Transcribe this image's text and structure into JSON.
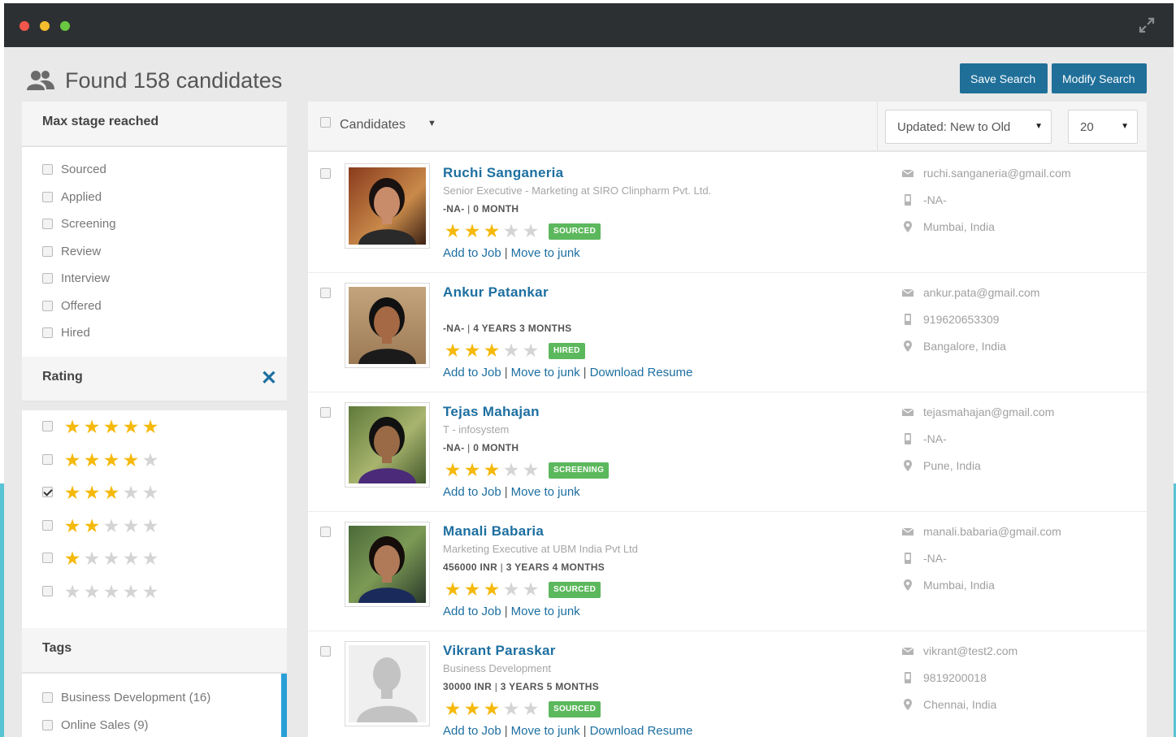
{
  "header": {
    "title": "Found 158 candidates",
    "save_search": "Save Search",
    "modify_search": "Modify Search"
  },
  "sidebar": {
    "stage": {
      "title": "Max stage reached",
      "items": [
        "Sourced",
        "Applied",
        "Screening",
        "Review",
        "Interview",
        "Offered",
        "Hired"
      ]
    },
    "rating": {
      "title": "Rating",
      "clear": "✕",
      "options": [
        {
          "stars": 5,
          "checked": false
        },
        {
          "stars": 4,
          "checked": false
        },
        {
          "stars": 3,
          "checked": true
        },
        {
          "stars": 2,
          "checked": false
        },
        {
          "stars": 1,
          "checked": false
        },
        {
          "stars": 0,
          "checked": false
        }
      ]
    },
    "tags": {
      "title": "Tags",
      "items": [
        "Business Development (16)",
        "Online Sales (9)"
      ]
    }
  },
  "toolbar": {
    "label": "Candidates",
    "sort_value": "Updated: New to Old",
    "count_value": "20"
  },
  "candidates": [
    {
      "name": "Ruchi Sanganeria",
      "title": "Senior Executive - Marketing at SIRO Clinpharm Pvt. Ltd.",
      "salary": "-NA-",
      "experience": "0 MONTH",
      "rating": 3,
      "stage": "SOURCED",
      "actions": [
        "Add to Job",
        "Move to junk"
      ],
      "email": "ruchi.sanganeria@gmail.com",
      "phone": "-NA-",
      "location": "Mumbai, India"
    },
    {
      "name": "Ankur Patankar",
      "title": "",
      "salary": "-NA-",
      "experience": "4 YEARS 3 MONTHS",
      "rating": 3,
      "stage": "HIRED",
      "actions": [
        "Add to Job",
        "Move to junk",
        "Download Resume"
      ],
      "email": "ankur.pata@gmail.com",
      "phone": "919620653309",
      "location": "Bangalore, India"
    },
    {
      "name": "Tejas Mahajan",
      "title": "T - infosystem",
      "salary": "-NA-",
      "experience": "0 MONTH",
      "rating": 3,
      "stage": "SCREENING",
      "actions": [
        "Add to Job",
        "Move to junk"
      ],
      "email": "tejasmahajan@gmail.com",
      "phone": "-NA-",
      "location": "Pune, India"
    },
    {
      "name": "Manali Babaria",
      "title": "Marketing Executive at UBM India Pvt Ltd",
      "salary": "456000 INR",
      "experience": "3 YEARS 4 MONTHS",
      "rating": 3,
      "stage": "SOURCED",
      "actions": [
        "Add to Job",
        "Move to junk"
      ],
      "email": "manali.babaria@gmail.com",
      "phone": "-NA-",
      "location": "Mumbai, India"
    },
    {
      "name": "Vikrant Paraskar",
      "title": "Business Development",
      "salary": "30000 INR",
      "experience": "3 YEARS 5 MONTHS",
      "rating": 3,
      "stage": "SOURCED",
      "actions": [
        "Add to Job",
        "Move to junk",
        "Download Resume"
      ],
      "email": "vikrant@test2.com",
      "phone": "9819200018",
      "location": "Chennai, India"
    }
  ],
  "colors": {
    "accent": "#1f6f99",
    "link": "#1d6fa0",
    "star": "#f5b90c",
    "badge": "#5cb85c",
    "titlebar": "#2d3033"
  }
}
